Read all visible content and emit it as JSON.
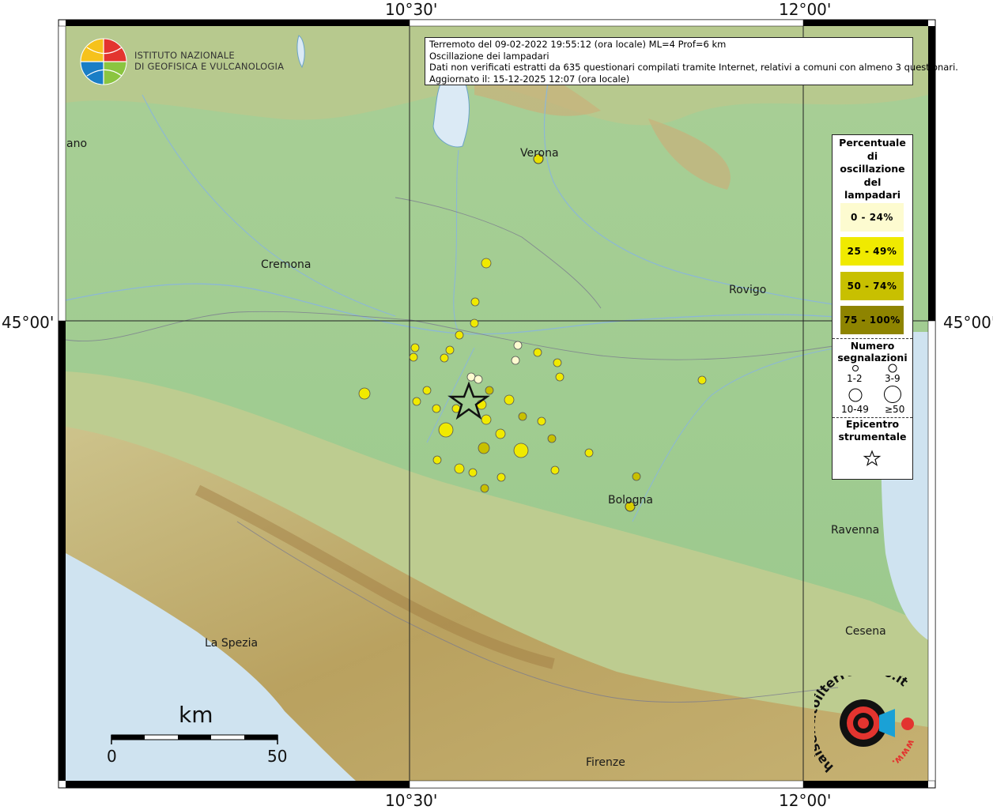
{
  "header": {
    "line1": "Terremoto del 09-02-2022 19:55:12 (ora locale) ML=4 Prof=6 km",
    "line2": "Oscillazione dei lampadari",
    "line3": "Dati non verificati estratti da 635 questionari compilati tramite Internet, relativi a comuni con almeno 3 questionari.",
    "line4": "Aggiornato il: 15-12-2025 12:07 (ora locale)"
  },
  "logo_ingv": {
    "line1": "ISTITUTO NAZIONALE",
    "line2": "DI GEOFISICA E VULCANOLOGIA"
  },
  "logo_hsit": {
    "text": "haisentitoilterremoto.it",
    "url_text": "www."
  },
  "coords": {
    "top_left": "10°30'",
    "top_right": "12°00'",
    "bottom_left": "10°30'",
    "bottom_right": "12°00'",
    "left_lat": "45°00'",
    "right_lat": "45°00'"
  },
  "cities": {
    "milano": "ano",
    "verona": "Verona",
    "cremona": "Cremona",
    "rovigo": "Rovigo",
    "bologna": "Bologna",
    "ravenna": "Ravenna",
    "la_spezia": "La Spezia",
    "cesena": "Cesena",
    "firenze": "Firenze"
  },
  "legend": {
    "title": [
      "Percentuale",
      "di",
      "oscillazione",
      "del",
      "lampadari"
    ],
    "classes": [
      {
        "label": "0 - 24%",
        "color": "#fdfbd0"
      },
      {
        "label": "25 - 49%",
        "color": "#f0ea00"
      },
      {
        "label": "50 - 74%",
        "color": "#c8c000"
      },
      {
        "label": "75 - 100%",
        "color": "#8e8400"
      }
    ],
    "size_title": [
      "Numero",
      "segnalazioni"
    ],
    "sizes": [
      "1-2",
      "3-9",
      "10-49",
      "≥50"
    ],
    "epicenter_title": [
      "Epicentro",
      "strumentale"
    ]
  },
  "scale": {
    "unit": "km",
    "min": "0",
    "max": "50"
  },
  "epicenter": {
    "lon": 10.73,
    "lat": 44.79
  }
}
